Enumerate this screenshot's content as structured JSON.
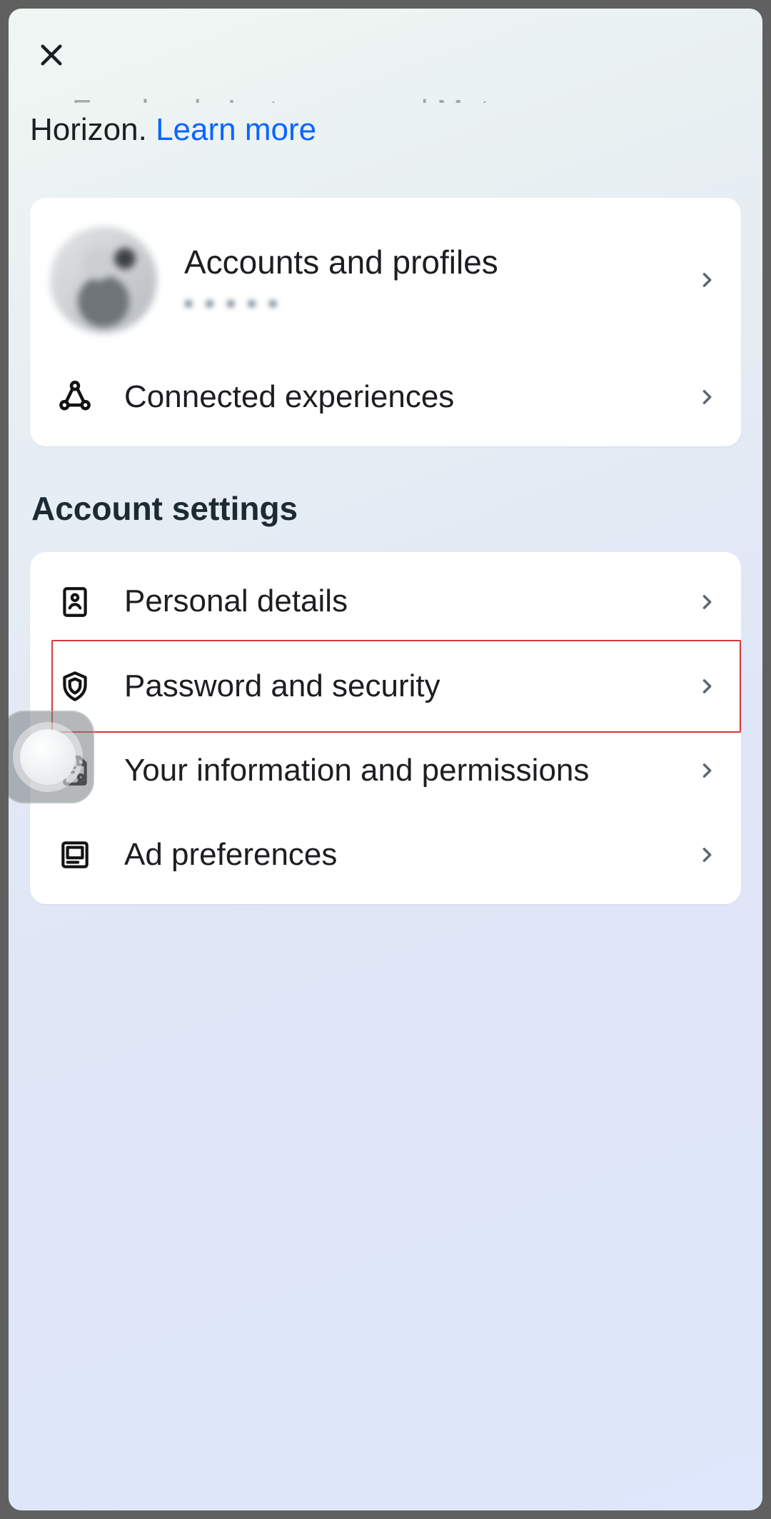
{
  "header": {
    "partial_text": "as Facebook, Instagram and Meta",
    "intro_prefix": "Horizon. ",
    "learn_more": "Learn more"
  },
  "profiles_card": {
    "accounts_profiles": "Accounts and profiles",
    "accounts_sub": "▪ ▪ ▪ ▪ ▪",
    "connected_experiences": "Connected experiences"
  },
  "section_title": "Account settings",
  "settings": {
    "personal_details": "Personal details",
    "password_security": "Password and security",
    "your_info_permissions": "Your information and permissions",
    "ad_preferences": "Ad preferences"
  }
}
